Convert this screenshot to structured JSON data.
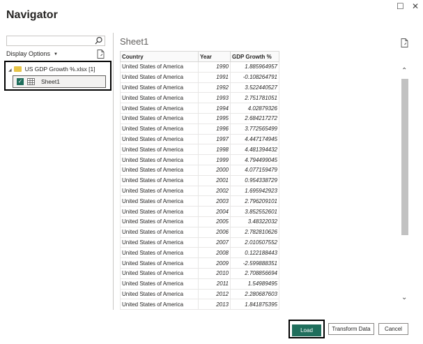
{
  "window": {
    "title": "Navigator",
    "restore_glyph": "☐",
    "close_glyph": "✕"
  },
  "left_panel": {
    "search": {
      "value": "",
      "placeholder": ""
    },
    "display_options_label": "Display Options",
    "tree": {
      "file_label": "US GDP Growth %.xlsx [1]",
      "sheet_label": "Sheet1",
      "sheet_checked": true
    }
  },
  "preview": {
    "title": "Sheet1",
    "columns": [
      "Country",
      "Year",
      "GDP Growth %"
    ],
    "rows": [
      [
        "United States of America",
        "1990",
        "1.885964957"
      ],
      [
        "United States of America",
        "1991",
        "-0.108264791"
      ],
      [
        "United States of America",
        "1992",
        "3.522440527"
      ],
      [
        "United States of America",
        "1993",
        "2.751781051"
      ],
      [
        "United States of America",
        "1994",
        "4.02879326"
      ],
      [
        "United States of America",
        "1995",
        "2.684217272"
      ],
      [
        "United States of America",
        "1996",
        "3.772565499"
      ],
      [
        "United States of America",
        "1997",
        "4.447174945"
      ],
      [
        "United States of America",
        "1998",
        "4.481394432"
      ],
      [
        "United States of America",
        "1999",
        "4.794499045"
      ],
      [
        "United States of America",
        "2000",
        "4.077159479"
      ],
      [
        "United States of America",
        "2001",
        "0.954338729"
      ],
      [
        "United States of America",
        "2002",
        "1.695942923"
      ],
      [
        "United States of America",
        "2003",
        "2.796209101"
      ],
      [
        "United States of America",
        "2004",
        "3.852552601"
      ],
      [
        "United States of America",
        "2005",
        "3.48322032"
      ],
      [
        "United States of America",
        "2006",
        "2.782810626"
      ],
      [
        "United States of America",
        "2007",
        "2.010507552"
      ],
      [
        "United States of America",
        "2008",
        "0.122188443"
      ],
      [
        "United States of America",
        "2009",
        "-2.599888351"
      ],
      [
        "United States of America",
        "2010",
        "2.708856694"
      ],
      [
        "United States of America",
        "2011",
        "1.54989495"
      ],
      [
        "United States of America",
        "2012",
        "2.280687603"
      ],
      [
        "United States of America",
        "2013",
        "1.841875395"
      ]
    ]
  },
  "footer": {
    "load_label": "Load",
    "transform_label": "Transform Data",
    "cancel_label": "Cancel"
  },
  "colors": {
    "accent": "#1f6e5c",
    "folder": "#e8c547",
    "scrollbar": "#c2c2c2"
  },
  "icons": [
    "search-icon",
    "new-doc-icon",
    "folder-icon",
    "table-icon",
    "checkbox-icon",
    "chevron-up-icon",
    "chevron-down-icon"
  ]
}
